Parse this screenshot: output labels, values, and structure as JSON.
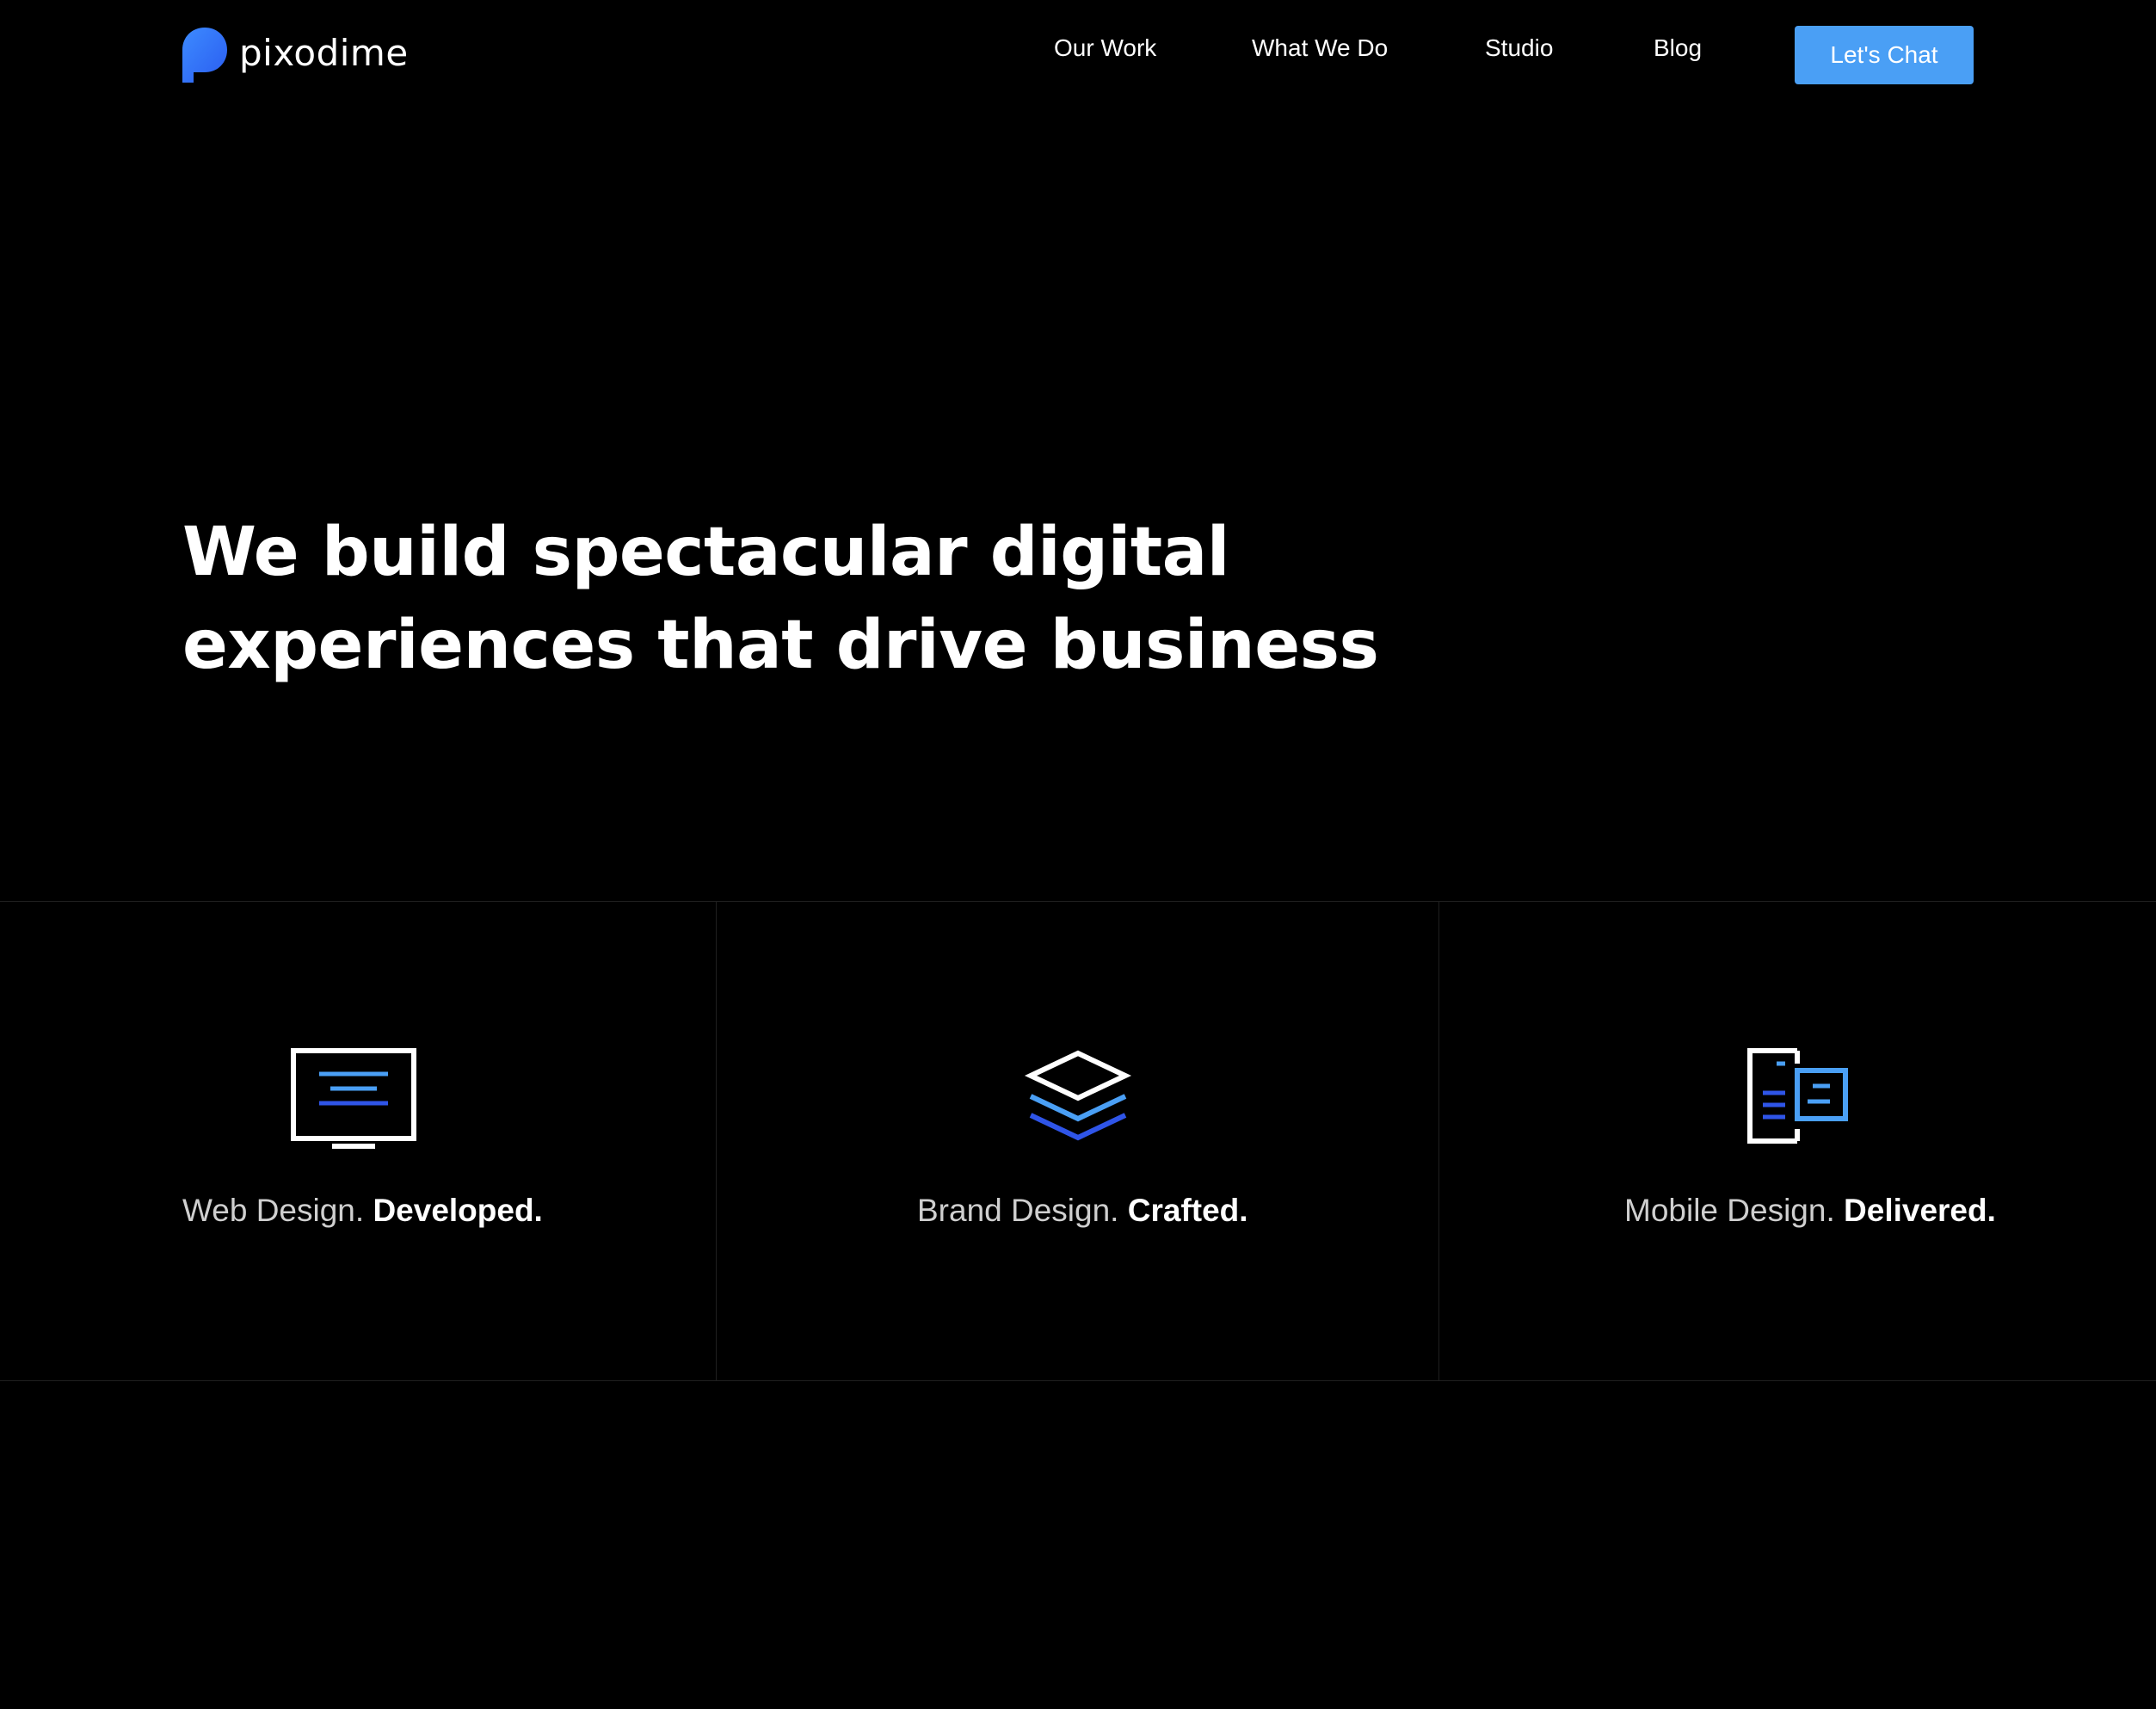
{
  "header": {
    "logo_text": "pixodime",
    "nav": [
      {
        "label": "Our Work"
      },
      {
        "label": "What We Do"
      },
      {
        "label": "Studio"
      },
      {
        "label": "Blog"
      }
    ],
    "cta_label": "Let's Chat"
  },
  "hero": {
    "title_line1": "We build spectacular digital",
    "title_line2": "experiences that drive business"
  },
  "services": [
    {
      "icon": "monitor-icon",
      "label": "Web Design.",
      "emphasis": "Developed."
    },
    {
      "icon": "layers-icon",
      "label": "Brand Design.",
      "emphasis": "Crafted."
    },
    {
      "icon": "mobile-devices-icon",
      "label": "Mobile Design.",
      "emphasis": "Delivered."
    }
  ],
  "colors": {
    "background": "#000000",
    "accent": "#4a9ff5",
    "icon_light_blue": "#4a9ff5",
    "icon_dark_blue": "#2f55e8",
    "text": "#ffffff",
    "muted_text": "#cfcfcf",
    "divider": "#1f1f1f"
  }
}
